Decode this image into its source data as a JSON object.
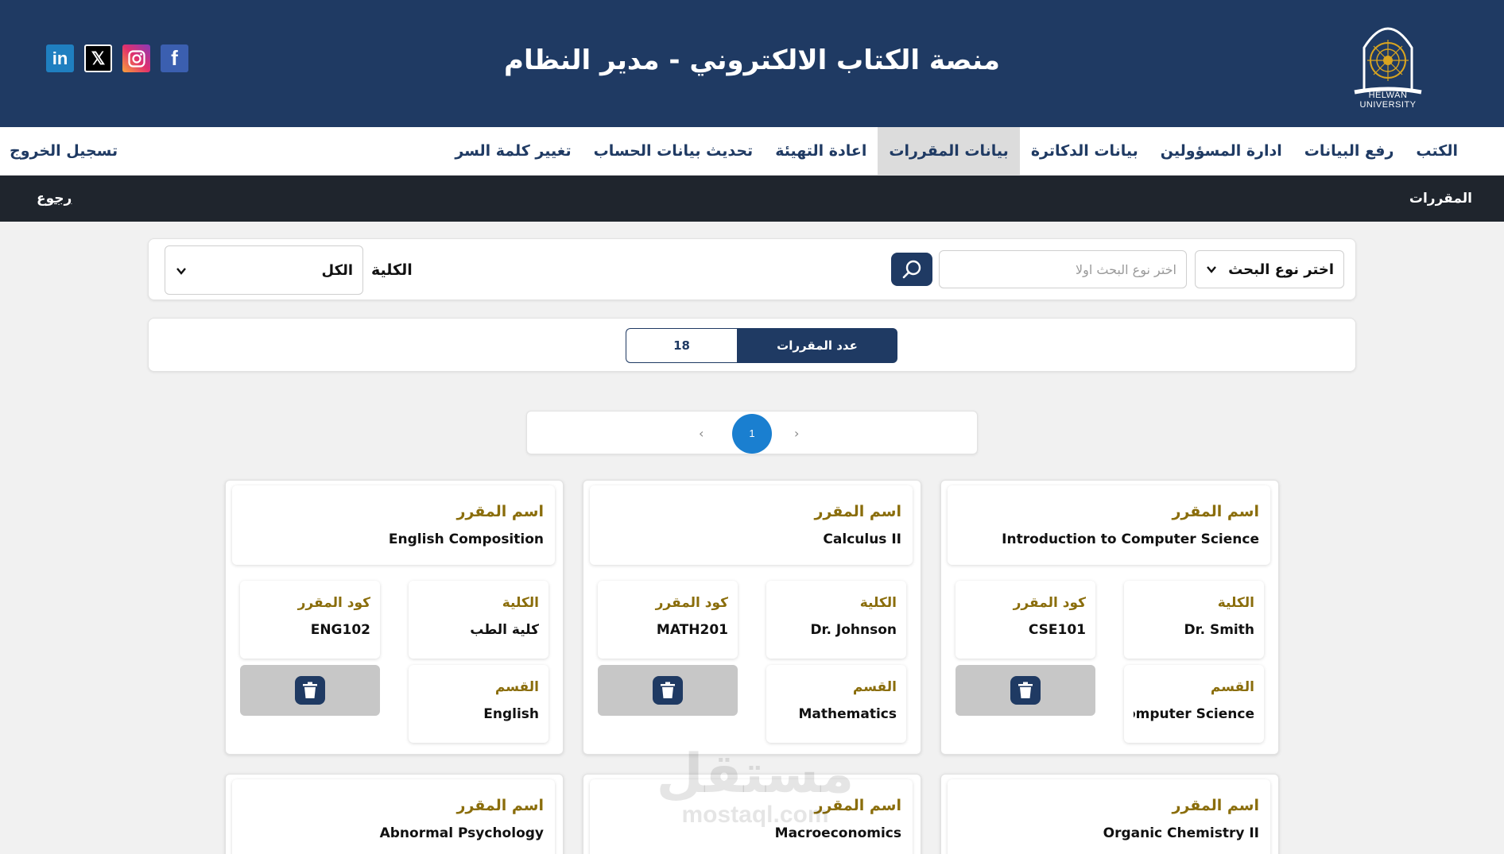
{
  "header": {
    "title": "منصة الكتاب الالكتروني - مدير النظام",
    "logo_text": "HELWAN UNIVERSITY",
    "social": [
      {
        "name": "linkedin",
        "glyph": "in"
      },
      {
        "name": "x",
        "glyph": "𝕏"
      },
      {
        "name": "instagram",
        "glyph": ""
      },
      {
        "name": "facebook",
        "glyph": "f"
      }
    ]
  },
  "nav": {
    "items": [
      "الكتب",
      "رفع البيانات",
      "ادارة المسؤولين",
      "بيانات الدكاترة",
      "بيانات المقررات",
      "اعادة التهيئة",
      "تحديث بيانات الحساب",
      "تغيير كلمة السر"
    ],
    "active": "بيانات المقررات",
    "logout": "تسجيل الخروج"
  },
  "subbar": {
    "title": "المقررات",
    "back": "رجوع"
  },
  "search": {
    "type_label": "اختر نوع البحث",
    "placeholder": "اختر نوع البحث اولا",
    "faculty_label": "الكلية",
    "faculty_value": "الكل"
  },
  "count": {
    "label": "عدد المقررات",
    "value": "18"
  },
  "pagination": {
    "prev": "‹",
    "current": "1",
    "next": "›"
  },
  "labels": {
    "course_name": "اسم المقرر",
    "faculty": "الكلية",
    "course_code": "كود المقرر",
    "department": "القسم"
  },
  "courses": [
    {
      "name": "Introduction to Computer Science",
      "faculty": "Dr. Smith",
      "code": "CSE101",
      "department": "Computer Science"
    },
    {
      "name": "Calculus II",
      "faculty": "Dr. Johnson",
      "code": "MATH201",
      "department": "Mathematics"
    },
    {
      "name": "English Composition",
      "faculty": "كلية الطب",
      "code": "ENG102",
      "department": "English"
    },
    {
      "name": "Organic Chemistry II"
    },
    {
      "name": "Macroeconomics"
    },
    {
      "name": "Abnormal Psychology"
    }
  ],
  "watermark": {
    "line1": "مستقل",
    "line2": "mostaql.com"
  },
  "colors": {
    "primary": "#1f3a63",
    "gold": "#8a6d0b",
    "subbar": "#1f252d",
    "page_badge": "#1a7fd0"
  }
}
